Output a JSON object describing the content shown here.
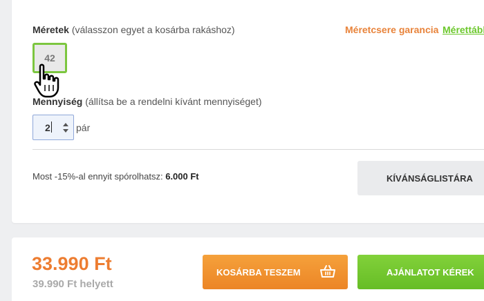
{
  "sizes": {
    "label": "Méretek",
    "hint": "(válasszon egyet a kosárba rakáshoz)",
    "guarantee_link": "Méretcsere garancia",
    "size_table_link": "Mérettábl",
    "options": [
      "42"
    ],
    "selected": "42"
  },
  "quantity": {
    "label": "Mennyiség",
    "hint": "(állítsa be a rendelni kívánt mennyiséget)",
    "value": "2",
    "unit": "pár"
  },
  "savings": {
    "text": "Most -15%-al ennyit spórolhatsz:",
    "amount": "6.000 Ft"
  },
  "wishlist_button": "KÍVÁNSÁGLISTÁRA",
  "price": {
    "current": "33.990 Ft",
    "original": "39.990 Ft helyett"
  },
  "add_to_cart_button": "KOSÁRBA TESZEM",
  "request_quote_button": "AJÁNLATOT KÉREK",
  "icons": {
    "cart": "shopping-basket-icon",
    "cursor": "hand-pointer-icon",
    "spinner": "up-down-arrows-icon"
  },
  "colors": {
    "accent_orange": "#ed7d31",
    "accent_green": "#6bc72b",
    "selected_border": "#7cc63f"
  }
}
